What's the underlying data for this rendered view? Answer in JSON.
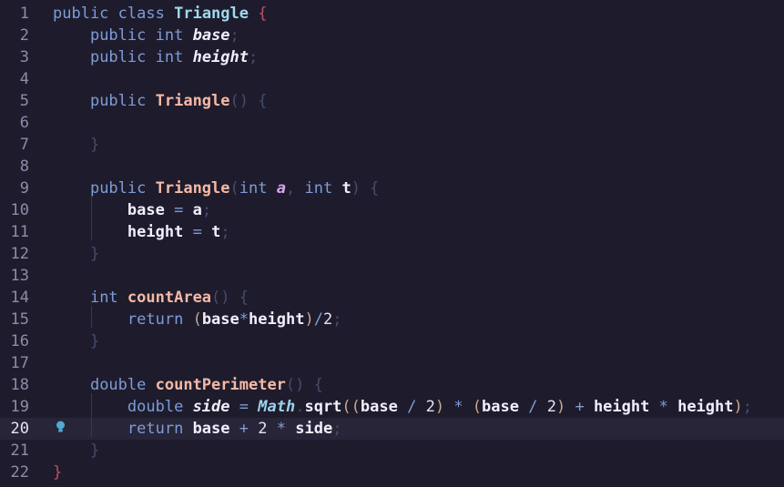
{
  "editor": {
    "language": "java",
    "active_line": 20,
    "lightbulb_line": 20,
    "colors": {
      "background": "#1e1c2c",
      "active_line": "#272537",
      "keyword": "#7e9cd8",
      "class_name": "#9ed9ef",
      "function": "#f5b9a6",
      "parameter": "#d7a5f0"
    },
    "lines": [
      {
        "n": "1",
        "tokens": [
          {
            "t": "public",
            "c": "kw"
          },
          {
            "t": " "
          },
          {
            "t": "class",
            "c": "kw"
          },
          {
            "t": " "
          },
          {
            "t": "Triangle",
            "c": "cls"
          },
          {
            "t": " "
          },
          {
            "t": "{",
            "c": "br1"
          }
        ]
      },
      {
        "n": "2",
        "tokens": [
          {
            "t": "    "
          },
          {
            "t": "public",
            "c": "kw"
          },
          {
            "t": " "
          },
          {
            "t": "int",
            "c": "kw"
          },
          {
            "t": " "
          },
          {
            "t": "base",
            "c": "idi"
          },
          {
            "t": ";",
            "c": "pun"
          }
        ]
      },
      {
        "n": "3",
        "tokens": [
          {
            "t": "    "
          },
          {
            "t": "public",
            "c": "kw"
          },
          {
            "t": " "
          },
          {
            "t": "int",
            "c": "kw"
          },
          {
            "t": " "
          },
          {
            "t": "height",
            "c": "idi"
          },
          {
            "t": ";",
            "c": "pun"
          }
        ]
      },
      {
        "n": "4",
        "tokens": []
      },
      {
        "n": "5",
        "tokens": [
          {
            "t": "    "
          },
          {
            "t": "public",
            "c": "kw"
          },
          {
            "t": " "
          },
          {
            "t": "Triangle",
            "c": "fn"
          },
          {
            "t": "() {",
            "c": "pun"
          }
        ]
      },
      {
        "n": "6",
        "tokens": []
      },
      {
        "n": "7",
        "tokens": [
          {
            "t": "    "
          },
          {
            "t": "}",
            "c": "pun"
          }
        ]
      },
      {
        "n": "8",
        "tokens": []
      },
      {
        "n": "9",
        "tokens": [
          {
            "t": "    "
          },
          {
            "t": "public",
            "c": "kw"
          },
          {
            "t": " "
          },
          {
            "t": "Triangle",
            "c": "fn"
          },
          {
            "t": "(",
            "c": "pun"
          },
          {
            "t": "int",
            "c": "kw"
          },
          {
            "t": " "
          },
          {
            "t": "a",
            "c": "par"
          },
          {
            "t": ", ",
            "c": "pun"
          },
          {
            "t": "int",
            "c": "kw"
          },
          {
            "t": " "
          },
          {
            "t": "t",
            "c": "id"
          },
          {
            "t": ") {",
            "c": "pun"
          }
        ]
      },
      {
        "n": "10",
        "tokens": [
          {
            "t": "        "
          },
          {
            "t": "base",
            "c": "id"
          },
          {
            "t": " "
          },
          {
            "t": "=",
            "c": "op"
          },
          {
            "t": " "
          },
          {
            "t": "a",
            "c": "id"
          },
          {
            "t": ";",
            "c": "pun"
          }
        ]
      },
      {
        "n": "11",
        "tokens": [
          {
            "t": "        "
          },
          {
            "t": "height",
            "c": "id"
          },
          {
            "t": " "
          },
          {
            "t": "=",
            "c": "op"
          },
          {
            "t": " "
          },
          {
            "t": "t",
            "c": "id"
          },
          {
            "t": ";",
            "c": "pun"
          }
        ]
      },
      {
        "n": "12",
        "tokens": [
          {
            "t": "    "
          },
          {
            "t": "}",
            "c": "pun"
          }
        ]
      },
      {
        "n": "13",
        "tokens": []
      },
      {
        "n": "14",
        "tokens": [
          {
            "t": "    "
          },
          {
            "t": "int",
            "c": "kw"
          },
          {
            "t": " "
          },
          {
            "t": "countArea",
            "c": "fn"
          },
          {
            "t": "() {",
            "c": "pun"
          }
        ]
      },
      {
        "n": "15",
        "tokens": [
          {
            "t": "        "
          },
          {
            "t": "return",
            "c": "kw"
          },
          {
            "t": " "
          },
          {
            "t": "(",
            "c": "paren"
          },
          {
            "t": "base",
            "c": "id"
          },
          {
            "t": "*",
            "c": "op"
          },
          {
            "t": "height",
            "c": "id"
          },
          {
            "t": ")",
            "c": "paren"
          },
          {
            "t": "/",
            "c": "op"
          },
          {
            "t": "2",
            "c": "num"
          },
          {
            "t": ";",
            "c": "pun"
          }
        ]
      },
      {
        "n": "16",
        "tokens": [
          {
            "t": "    "
          },
          {
            "t": "}",
            "c": "pun"
          }
        ]
      },
      {
        "n": "17",
        "tokens": []
      },
      {
        "n": "18",
        "tokens": [
          {
            "t": "    "
          },
          {
            "t": "double",
            "c": "kw"
          },
          {
            "t": " "
          },
          {
            "t": "countPerimeter",
            "c": "fn"
          },
          {
            "t": "() {",
            "c": "pun"
          }
        ]
      },
      {
        "n": "19",
        "tokens": [
          {
            "t": "        "
          },
          {
            "t": "double",
            "c": "kw"
          },
          {
            "t": " "
          },
          {
            "t": "side",
            "c": "idi"
          },
          {
            "t": " "
          },
          {
            "t": "=",
            "c": "op"
          },
          {
            "t": " "
          },
          {
            "t": "Math",
            "c": "mth"
          },
          {
            "t": ".",
            "c": "pun"
          },
          {
            "t": "sqrt",
            "c": "id"
          },
          {
            "t": "((",
            "c": "paren"
          },
          {
            "t": "base",
            "c": "id"
          },
          {
            "t": " / ",
            "c": "op"
          },
          {
            "t": "2",
            "c": "num"
          },
          {
            "t": ")",
            "c": "paren"
          },
          {
            "t": " * ",
            "c": "op"
          },
          {
            "t": "(",
            "c": "paren"
          },
          {
            "t": "base",
            "c": "id"
          },
          {
            "t": " / ",
            "c": "op"
          },
          {
            "t": "2",
            "c": "num"
          },
          {
            "t": ")",
            "c": "paren"
          },
          {
            "t": " + ",
            "c": "op"
          },
          {
            "t": "height",
            "c": "id"
          },
          {
            "t": " * ",
            "c": "op"
          },
          {
            "t": "height",
            "c": "id"
          },
          {
            "t": ")",
            "c": "paren"
          },
          {
            "t": ";",
            "c": "pun"
          }
        ]
      },
      {
        "n": "20",
        "tokens": [
          {
            "t": "        "
          },
          {
            "t": "return",
            "c": "kw"
          },
          {
            "t": " "
          },
          {
            "t": "base",
            "c": "id"
          },
          {
            "t": " "
          },
          {
            "t": "+",
            "c": "op"
          },
          {
            "t": " "
          },
          {
            "t": "2",
            "c": "num"
          },
          {
            "t": " "
          },
          {
            "t": "*",
            "c": "op"
          },
          {
            "t": " "
          },
          {
            "t": "side",
            "c": "id"
          },
          {
            "t": ";",
            "c": "pun"
          }
        ]
      },
      {
        "n": "21",
        "tokens": [
          {
            "t": "    "
          },
          {
            "t": "}",
            "c": "pun"
          }
        ]
      },
      {
        "n": "22",
        "tokens": [
          {
            "t": "}",
            "c": "br1"
          }
        ]
      }
    ]
  }
}
